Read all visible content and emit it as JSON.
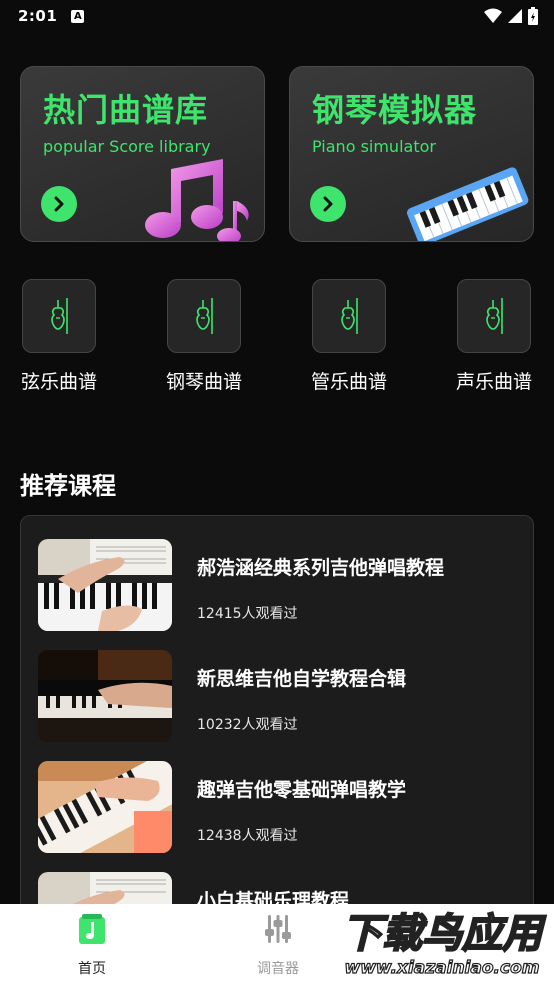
{
  "status_bar": {
    "time": "2:01",
    "a_badge": "A"
  },
  "features": [
    {
      "title": "热门曲谱库",
      "subtitle": "popular Score library",
      "icon": "music-note-icon"
    },
    {
      "title": "钢琴模拟器",
      "subtitle": "Piano simulator",
      "icon": "keyboard-icon"
    }
  ],
  "categories": [
    {
      "label": "弦乐曲谱",
      "icon": "violin-icon"
    },
    {
      "label": "钢琴曲谱",
      "icon": "violin-icon"
    },
    {
      "label": "管乐曲谱",
      "icon": "violin-icon"
    },
    {
      "label": "声乐曲谱",
      "icon": "violin-icon"
    }
  ],
  "section": {
    "title": "推荐课程"
  },
  "courses": [
    {
      "title": "郝浩涵经典系列吉他弹唱教程",
      "views": "12415人观看过"
    },
    {
      "title": "新思维吉他自学教程合辑",
      "views": "10232人观看过"
    },
    {
      "title": "趣弹吉他零基础弹唱教学",
      "views": "12438人观看过"
    },
    {
      "title": "小白基础乐理教程",
      "views": ""
    }
  ],
  "tabs": [
    {
      "label": "首页",
      "icon": "home-score-icon",
      "active": true
    },
    {
      "label": "调音器",
      "icon": "tuner-sliders-icon",
      "active": false
    }
  ],
  "watermark": {
    "text_main": "下载鸟应用",
    "text_url": "www.xiazainiao.com"
  },
  "colors": {
    "accent": "#3ee46c",
    "background": "#0b0b0b",
    "card": "#2a2a2a"
  }
}
